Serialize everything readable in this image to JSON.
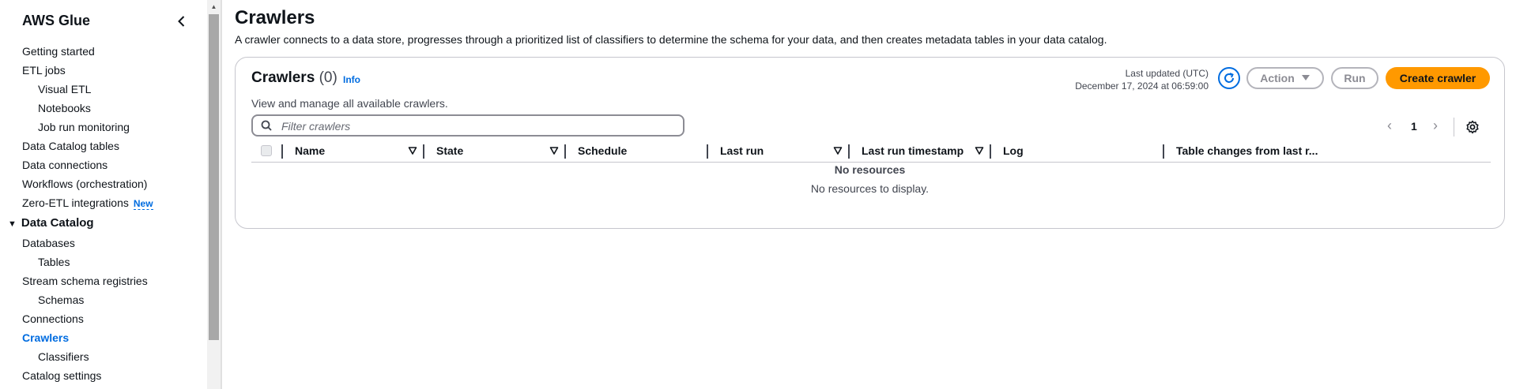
{
  "sidebar": {
    "title": "AWS Glue",
    "items": [
      {
        "label": "Getting started",
        "level": 1
      },
      {
        "label": "ETL jobs",
        "level": 1
      },
      {
        "label": "Visual ETL",
        "level": 2
      },
      {
        "label": "Notebooks",
        "level": 2
      },
      {
        "label": "Job run monitoring",
        "level": 2
      },
      {
        "label": "Data Catalog tables",
        "level": 1
      },
      {
        "label": "Data connections",
        "level": 1
      },
      {
        "label": "Workflows (orchestration)",
        "level": 1
      },
      {
        "label": "Zero-ETL integrations",
        "level": 1,
        "badge": "New"
      }
    ],
    "section": {
      "label": "Data Catalog",
      "items": [
        {
          "label": "Databases",
          "level": 1
        },
        {
          "label": "Tables",
          "level": 2
        },
        {
          "label": "Stream schema registries",
          "level": 1
        },
        {
          "label": "Schemas",
          "level": 2
        },
        {
          "label": "Connections",
          "level": 1
        },
        {
          "label": "Crawlers",
          "level": 1,
          "active": true
        },
        {
          "label": "Classifiers",
          "level": 2
        },
        {
          "label": "Catalog settings",
          "level": 1
        }
      ]
    }
  },
  "page": {
    "title": "Crawlers",
    "description": "A crawler connects to a data store, progresses through a prioritized list of classifiers to determine the schema for your data, and then creates metadata tables in your data catalog."
  },
  "card": {
    "title": "Crawlers",
    "count": "(0)",
    "info": "Info",
    "description": "View and manage all available crawlers.",
    "last_updated_label": "Last updated (UTC)",
    "last_updated_value": "December 17, 2024 at 06:59:00",
    "action_label": "Action",
    "run_label": "Run",
    "create_label": "Create crawler",
    "filter_placeholder": "Filter crawlers",
    "page_number": "1",
    "columns": [
      "Name",
      "State",
      "Schedule",
      "Last run",
      "Last run timestamp",
      "Log",
      "Table changes from last r..."
    ],
    "empty_title": "No resources",
    "empty_desc": "No resources to display."
  },
  "colors": {
    "accent": "#006ce0",
    "primary_button": "#ff9900"
  }
}
